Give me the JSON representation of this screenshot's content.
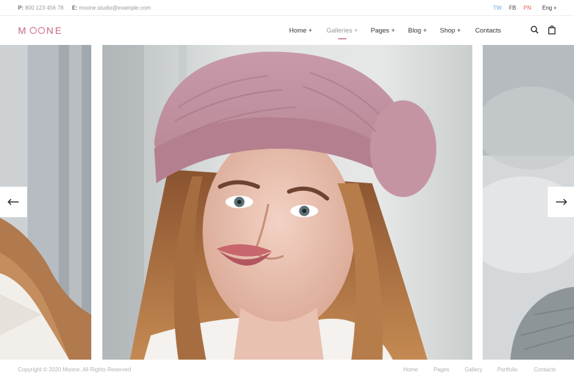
{
  "colors": {
    "accent": "#d88ca4",
    "twitter": "#6aa7e0",
    "facebook": "#444444",
    "pinterest": "#e0604f",
    "text_muted": "#9a9a9a"
  },
  "topbar": {
    "phone_prefix": "P:",
    "phone": "800 123 456 78",
    "email_prefix": "E:",
    "email": "moone.studio@example.com",
    "social": [
      "TW",
      "FB",
      "PN"
    ],
    "language": "Eng +"
  },
  "header": {
    "logo": "MOONE",
    "nav": [
      {
        "label": "Home +"
      },
      {
        "label": "Galleries +"
      },
      {
        "label": "Pages +"
      },
      {
        "label": "Blog +"
      },
      {
        "label": "Shop +"
      },
      {
        "label": "Contacts"
      }
    ],
    "icons": [
      "search-icon",
      "shopping-bag-icon"
    ]
  },
  "slider": {
    "prev_icon": "arrow-left-icon",
    "next_icon": "arrow-right-icon"
  },
  "footer": {
    "copyright": "Copyright © 2020 Moone. All Rights Reserved",
    "links": [
      "Home",
      "Pages",
      "Gallery",
      "Portfolio",
      "Contacts"
    ]
  }
}
